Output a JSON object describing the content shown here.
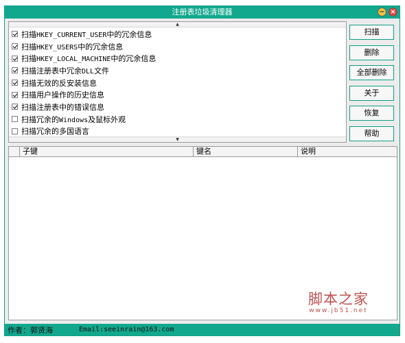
{
  "window": {
    "title": "注册表垃圾清理器"
  },
  "checklist": {
    "items": [
      {
        "label": "扫描HKEY_CURRENT_USER中的冗余信息",
        "checked": true
      },
      {
        "label": "扫描HKEY_USERS中的冗余信息",
        "checked": true
      },
      {
        "label": "扫描HKEY_LOCAL_MACHINE中的冗余信息",
        "checked": true
      },
      {
        "label": "扫描注册表中冗余DLL文件",
        "checked": true
      },
      {
        "label": "扫描无效的反安装信息",
        "checked": true
      },
      {
        "label": "扫描用户操作的历史信息",
        "checked": true
      },
      {
        "label": "扫描注册表中的错误信息",
        "checked": true
      },
      {
        "label": "扫描冗余的Windows及鼠标外观",
        "checked": false
      },
      {
        "label": "扫描冗余的多国语言",
        "checked": false
      }
    ]
  },
  "buttons": {
    "scan": "扫描",
    "delete": "删除",
    "delete_all": "全部删除",
    "about": "关于",
    "restore": "恢复",
    "help": "帮助"
  },
  "table": {
    "columns": [
      "子键",
      "键名",
      "说明"
    ]
  },
  "watermark": {
    "main": "脚本之家",
    "url": "www.jb51.net"
  },
  "status": {
    "author": "作者：郭贤海",
    "email": "Email:seeinrain@163.com"
  },
  "colors": {
    "accent": "#12a88e"
  }
}
